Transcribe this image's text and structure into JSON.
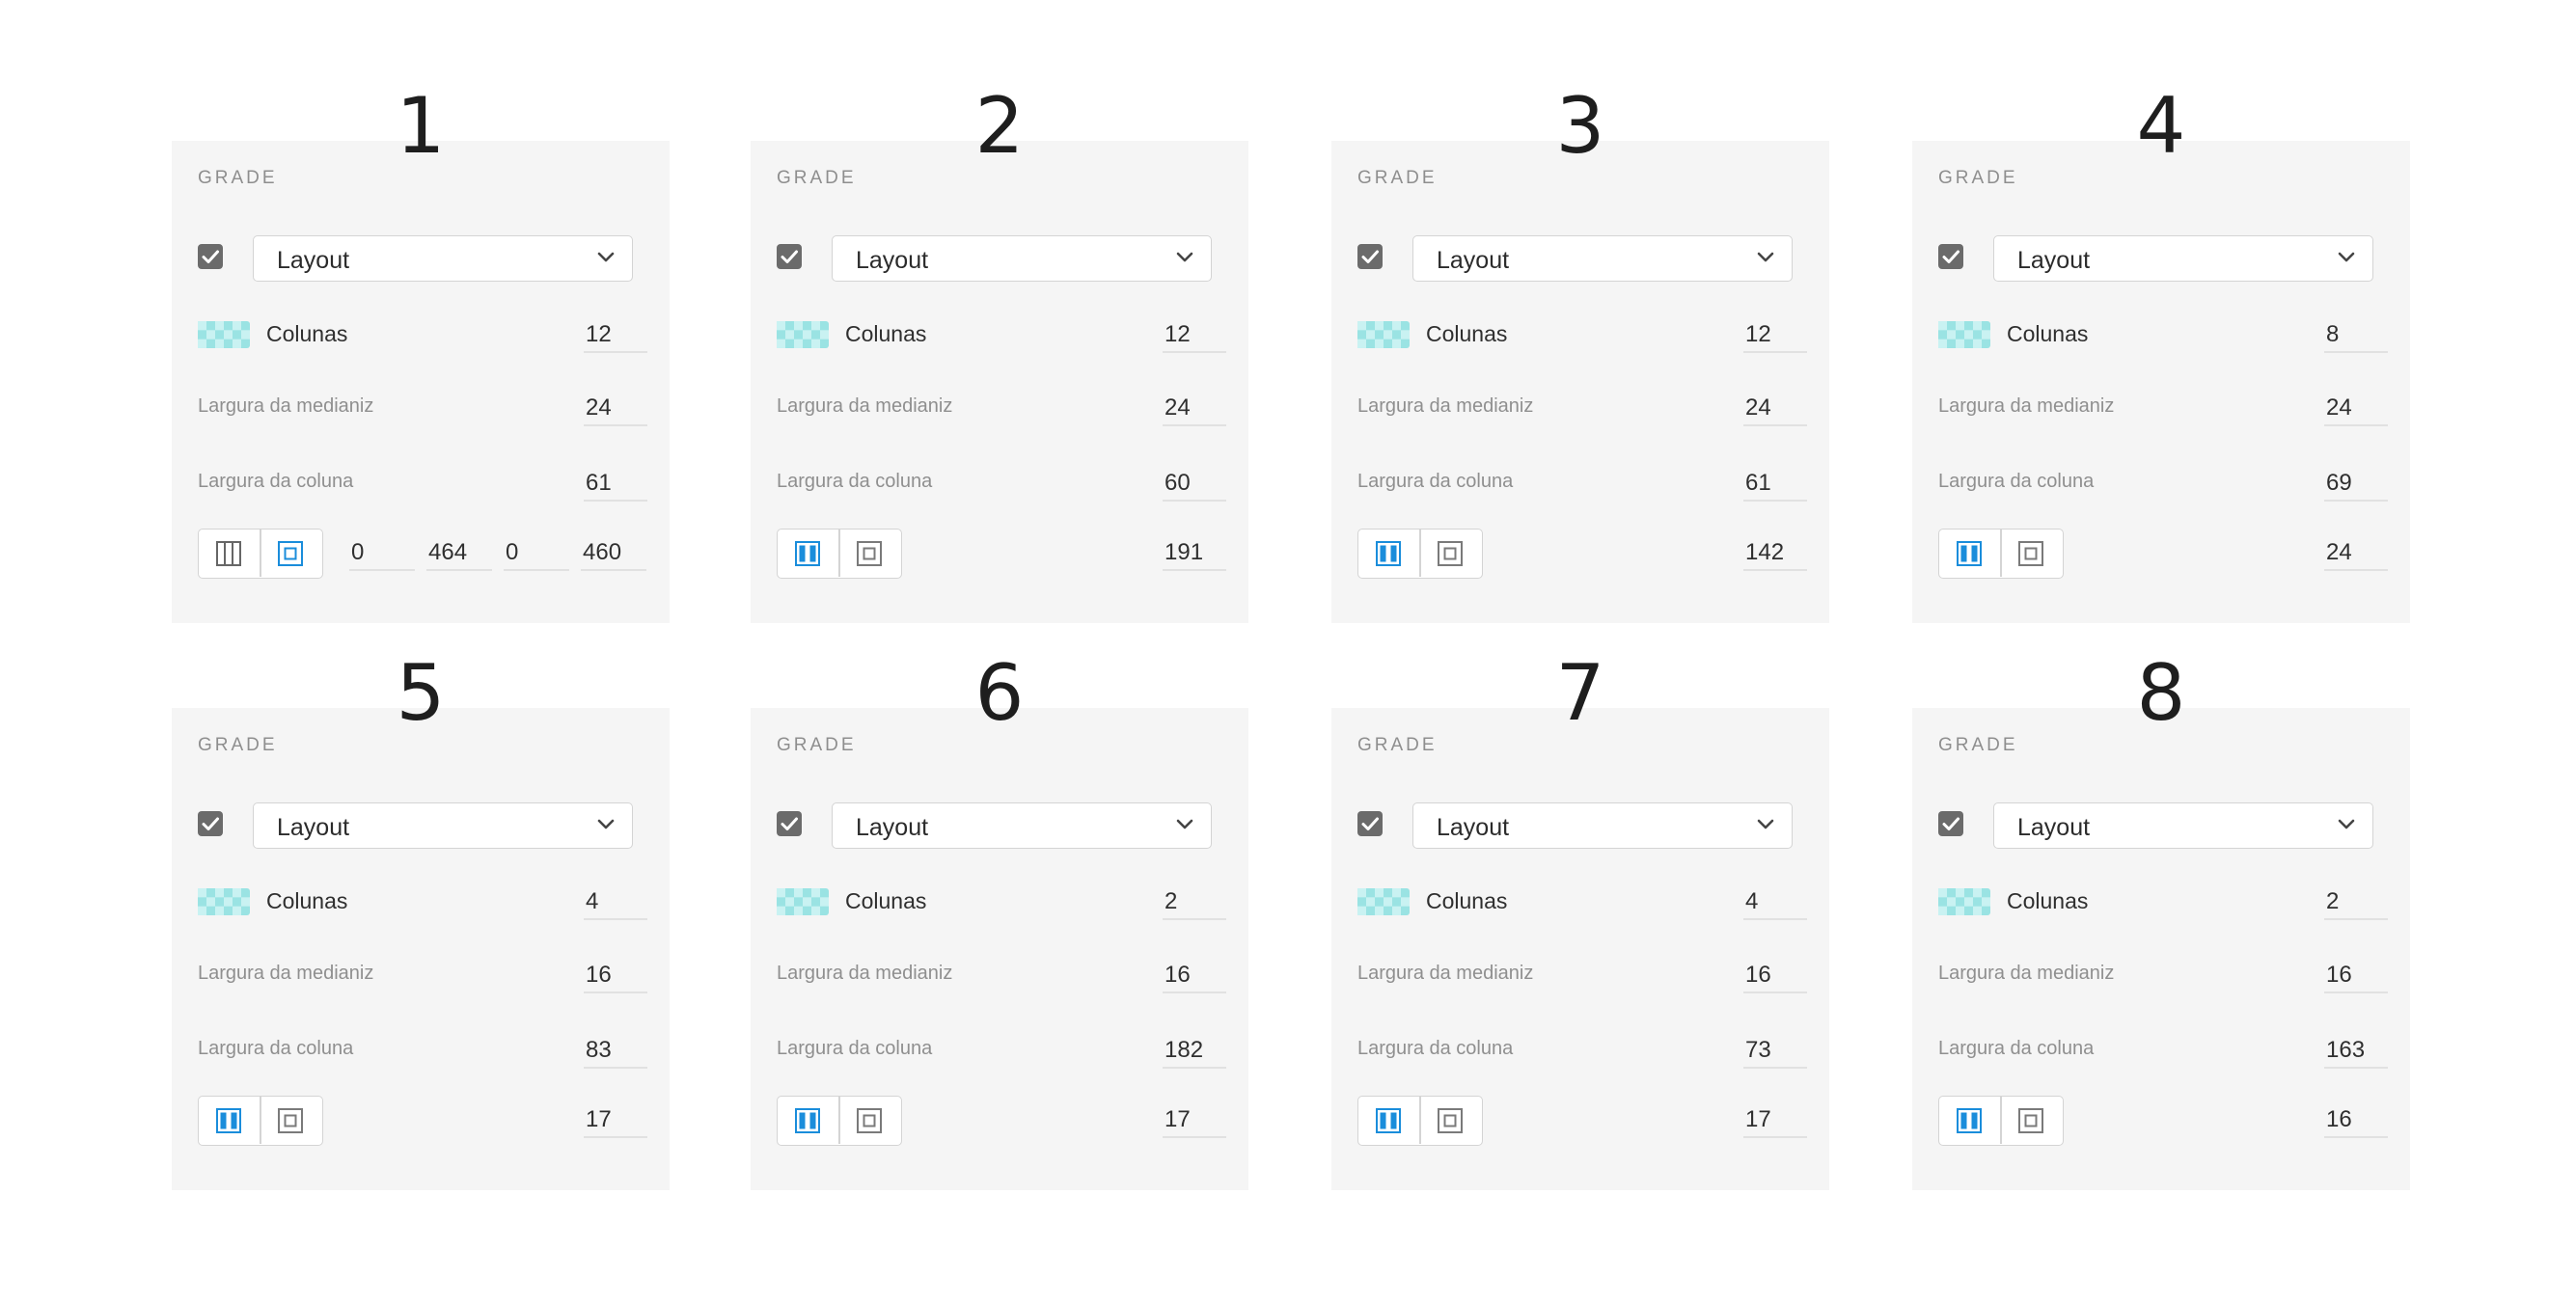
{
  "panels": [
    {
      "number": "1",
      "section_title": "GRADE",
      "layout_select": "Layout",
      "columns_label": "Colunas",
      "columns": "12",
      "gutter_label": "Largura da medianiz",
      "gutter": "24",
      "column_width_label": "Largura da coluna",
      "column_width": "61",
      "active_mode": "inset",
      "inset_values": [
        "0",
        "464",
        "0",
        "460"
      ],
      "offset": ""
    },
    {
      "number": "2",
      "section_title": "GRADE",
      "layout_select": "Layout",
      "columns_label": "Colunas",
      "columns": "12",
      "gutter_label": "Largura da medianiz",
      "gutter": "24",
      "column_width_label": "Largura da coluna",
      "column_width": "60",
      "active_mode": "center",
      "inset_values": [],
      "offset": "191"
    },
    {
      "number": "3",
      "section_title": "GRADE",
      "layout_select": "Layout",
      "columns_label": "Colunas",
      "columns": "12",
      "gutter_label": "Largura da medianiz",
      "gutter": "24",
      "column_width_label": "Largura da coluna",
      "column_width": "61",
      "active_mode": "center",
      "inset_values": [],
      "offset": "142"
    },
    {
      "number": "4",
      "section_title": "GRADE",
      "layout_select": "Layout",
      "columns_label": "Colunas",
      "columns": "8",
      "gutter_label": "Largura da medianiz",
      "gutter": "24",
      "column_width_label": "Largura da coluna",
      "column_width": "69",
      "active_mode": "center",
      "inset_values": [],
      "offset": "24"
    },
    {
      "number": "5",
      "section_title": "GRADE",
      "layout_select": "Layout",
      "columns_label": "Colunas",
      "columns": "4",
      "gutter_label": "Largura da medianiz",
      "gutter": "16",
      "column_width_label": "Largura da coluna",
      "column_width": "83",
      "active_mode": "center",
      "inset_values": [],
      "offset": "17"
    },
    {
      "number": "6",
      "section_title": "GRADE",
      "layout_select": "Layout",
      "columns_label": "Colunas",
      "columns": "2",
      "gutter_label": "Largura da medianiz",
      "gutter": "16",
      "column_width_label": "Largura da coluna",
      "column_width": "182",
      "active_mode": "center",
      "inset_values": [],
      "offset": "17"
    },
    {
      "number": "7",
      "section_title": "GRADE",
      "layout_select": "Layout",
      "columns_label": "Colunas",
      "columns": "4",
      "gutter_label": "Largura da medianiz",
      "gutter": "16",
      "column_width_label": "Largura da coluna",
      "column_width": "73",
      "active_mode": "center",
      "inset_values": [],
      "offset": "17"
    },
    {
      "number": "8",
      "section_title": "GRADE",
      "layout_select": "Layout",
      "columns_label": "Colunas",
      "columns": "2",
      "gutter_label": "Largura da medianiz",
      "gutter": "16",
      "column_width_label": "Largura da coluna",
      "column_width": "163",
      "active_mode": "center",
      "inset_values": [],
      "offset": "16"
    }
  ],
  "colors": {
    "accent": "#1a8ddb",
    "panel_bg": "#f5f5f5",
    "checkbox": "#6b6b6b"
  },
  "icons": {
    "checkbox": "checkbox-checked-icon",
    "dropdown": "chevron-down-icon",
    "grid_swatch": "grid-swatch-icon",
    "mode_columns": "columns-layout-icon",
    "mode_center": "center-column-icon",
    "mode_inset": "inset-square-icon"
  }
}
